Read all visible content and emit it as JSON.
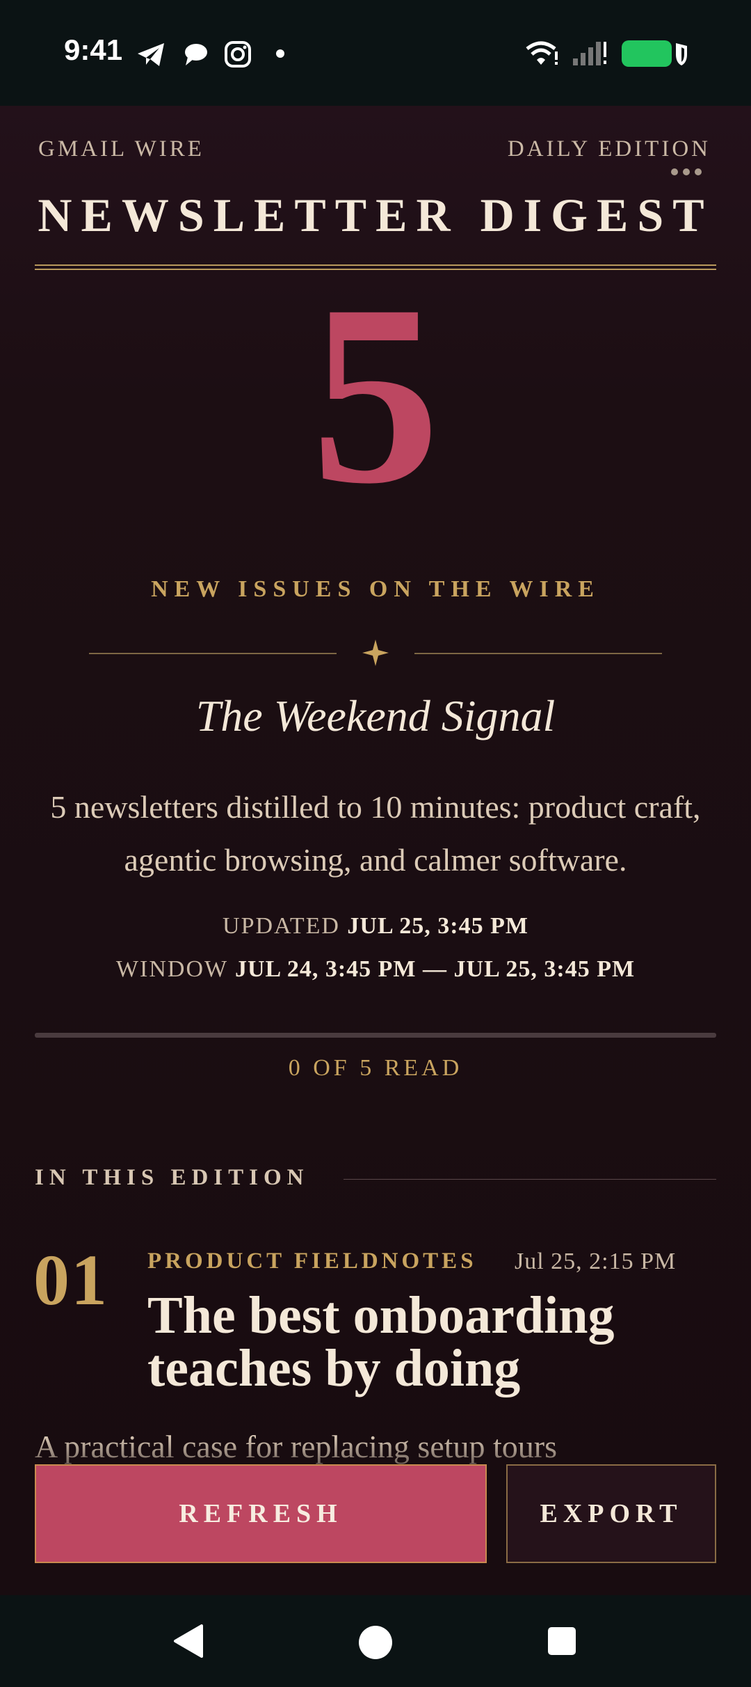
{
  "status_bar": {
    "time": "9:41"
  },
  "header": {
    "brand": "GMAIL WIRE",
    "edition": "DAILY EDITION",
    "title": "NEWSLETTER DIGEST"
  },
  "hero": {
    "count": "5",
    "count_label": "NEW ISSUES ON THE WIRE",
    "digest_title": "The Weekend Signal",
    "lead": "5 newsletters distilled to 10 minutes: product craft, agentic browsing, and calmer software.",
    "updated_label": "UPDATED",
    "updated_value": "JUL 25, 3:45 PM",
    "window_label": "WINDOW",
    "window_value": "JUL 24, 3:45 PM — JUL 25, 3:45 PM"
  },
  "progress": {
    "read": 0,
    "total": 5,
    "label": "0 OF 5 READ"
  },
  "edition": {
    "section_title": "IN THIS EDITION",
    "items": [
      {
        "index": "01",
        "source": "PRODUCT FIELDNOTES",
        "date": "Jul 25, 2:15 PM",
        "headline": "The best onboarding teaches by doing",
        "summary": "A practical case for replacing setup tours"
      }
    ]
  },
  "actions": {
    "refresh": "REFRESH",
    "export": "EXPORT"
  },
  "colors": {
    "accent": "#bd4761",
    "gold": "#c9a45f",
    "background": "#180c10",
    "text": "#f4e8d8"
  }
}
